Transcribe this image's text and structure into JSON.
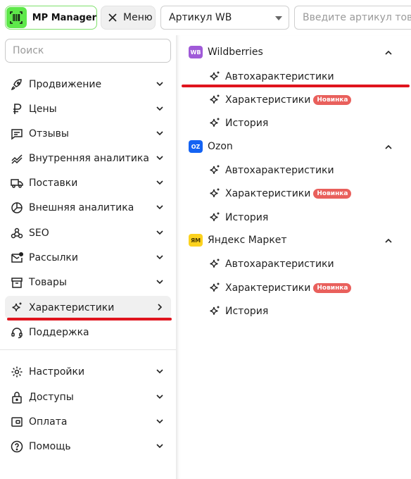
{
  "header": {
    "app_name": "MP Manager",
    "menu_label": "Меню",
    "select_value": "Артикул WB",
    "article_placeholder": "Введите артикул товара"
  },
  "sidebar": {
    "search_placeholder": "Поиск",
    "items": [
      {
        "label": "Продвижение",
        "icon": "rocket-icon"
      },
      {
        "label": "Цены",
        "icon": "ruble-icon"
      },
      {
        "label": "Отзывы",
        "icon": "message-icon"
      },
      {
        "label": "Внутренняя аналитика",
        "icon": "trend-icon"
      },
      {
        "label": "Поставки",
        "icon": "truck-icon"
      },
      {
        "label": "Внешняя аналитика",
        "icon": "chart-pie-icon"
      },
      {
        "label": "SEO",
        "icon": "seo-icon"
      },
      {
        "label": "Рассылки",
        "icon": "mail-icon"
      },
      {
        "label": "Товары",
        "icon": "box-icon"
      },
      {
        "label": "Характеристики",
        "icon": "sparkle-icon"
      },
      {
        "label": "Поддержка",
        "icon": "headset-icon"
      }
    ],
    "bottom_items": [
      {
        "label": "Настройки",
        "icon": "gear-icon"
      },
      {
        "label": "Доступы",
        "icon": "lock-icon"
      },
      {
        "label": "Оплата",
        "icon": "wallet-icon"
      },
      {
        "label": "Помощь",
        "icon": "help-icon"
      }
    ]
  },
  "panel": {
    "marketplaces": [
      {
        "name": "Wildberries",
        "badge": "WB",
        "badge_color": "#a05ad8",
        "items": [
          {
            "label": "Автохарактеристики"
          },
          {
            "label": "Характеристики",
            "badge": "Новинка"
          },
          {
            "label": "История"
          }
        ]
      },
      {
        "name": "Ozon",
        "badge": "OZ",
        "badge_color": "#1463f3",
        "items": [
          {
            "label": "Автохарактеристики"
          },
          {
            "label": "Характеристики",
            "badge": "Новинка"
          },
          {
            "label": "История"
          }
        ]
      },
      {
        "name": "Яндекс Маркет",
        "badge": "ЯМ",
        "badge_color": "#fcd21e",
        "items": [
          {
            "label": "Автохарактеристики"
          },
          {
            "label": "Характеристики",
            "badge": "Новинка"
          },
          {
            "label": "История"
          }
        ]
      }
    ]
  },
  "colors": {
    "accent_green": "#5ee84a",
    "new_badge": "#e9605c",
    "highlight_underline": "#e0141e"
  }
}
